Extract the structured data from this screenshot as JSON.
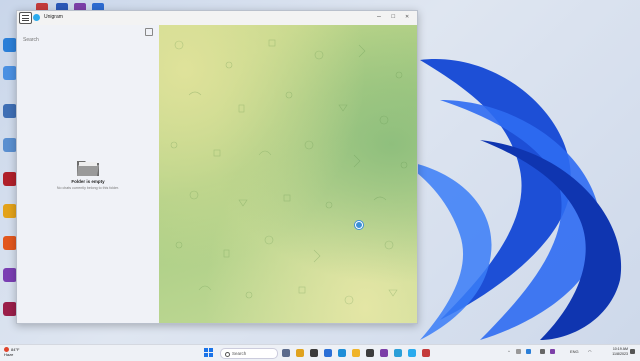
{
  "window": {
    "title": "Unigram",
    "controls": {
      "minimize": "–",
      "maximize": "☐",
      "close": "✕"
    }
  },
  "sidebar": {
    "search_placeholder": "Search",
    "empty_title": "Folder is empty",
    "empty_subtitle": "No chats currently belong to this folder."
  },
  "taskbar": {
    "weather_temp": "84°F",
    "weather_desc": "Haze",
    "search_placeholder": "Search",
    "language": "ENG",
    "time": "10:19 AM",
    "date": "11/8/2023"
  },
  "colors": {
    "accent": "#2aabee",
    "wallpaper_bloom": "#1f4fd8",
    "chat_bg_top": "#dfe29a",
    "chat_bg_mid": "#a9cd84"
  },
  "icons": {
    "menu": "hamburger-icon",
    "app": "telegram-icon",
    "filter": "filter-icon",
    "folder": "folder-icon",
    "start": "windows-start-icon"
  }
}
